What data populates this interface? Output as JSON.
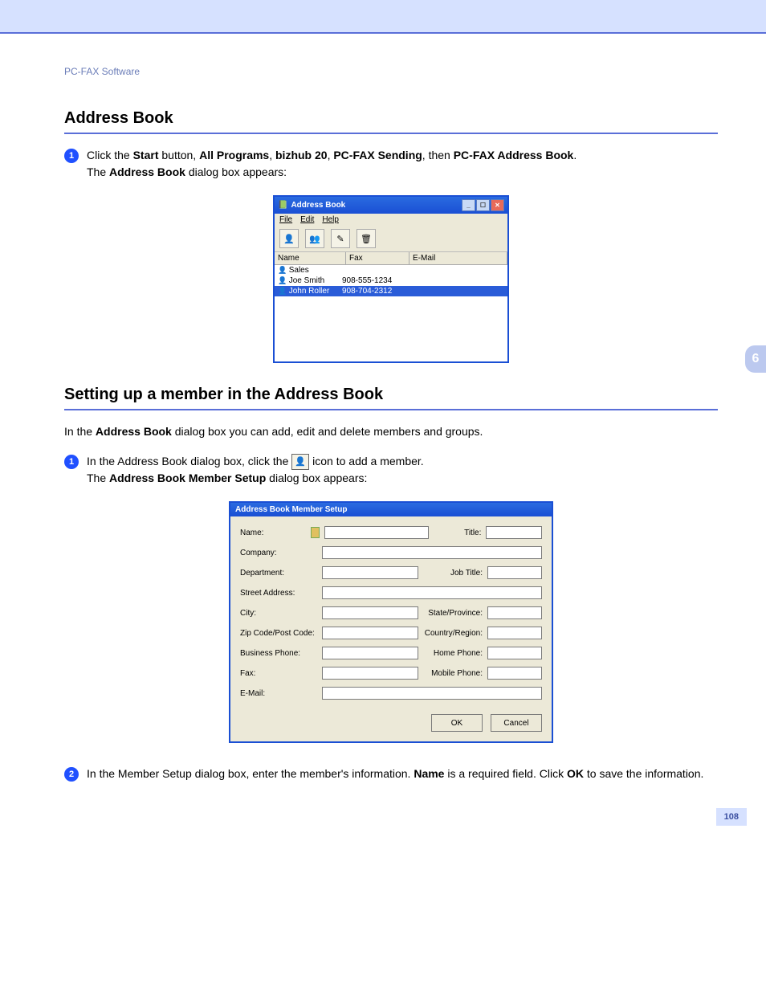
{
  "chapter_num": "6",
  "page_num": "108",
  "header": "PC-FAX Software",
  "h2_1": "Address Book",
  "h2_2": "Setting up a member in the Address Book",
  "step1": {
    "pre": "Click the ",
    "b1": "Start",
    "t1": " button, ",
    "b2": "All Programs",
    "t2": ", ",
    "b3": "bizhub 20",
    "t3": ", ",
    "b4": "PC-FAX Sending",
    "t4": ", then ",
    "b5": "PC-FAX Address Book",
    "t5": ".",
    "line2a": "The ",
    "line2b": "Address Book",
    "line2c": " dialog box appears:"
  },
  "intro2": {
    "a": "In the ",
    "b": "Address Book",
    "c": " dialog box you can add, edit and delete members and groups."
  },
  "step2a": {
    "a": "In the Address Book dialog box, click the ",
    "b": " icon to add a member.",
    "c1": "The ",
    "c2": "Address Book Member Setup",
    "c3": " dialog box appears:"
  },
  "step2b": {
    "a": "In the Member Setup dialog box, enter the member's information. ",
    "b": "Name",
    "c": " is a required field. Click ",
    "d": "OK",
    "e": " to save the information."
  },
  "ab": {
    "title": "Address Book",
    "menu": {
      "file": "File",
      "edit": "Edit",
      "help": "Help"
    },
    "cols": {
      "name": "Name",
      "fax": "Fax",
      "email": "E-Mail"
    },
    "rows": [
      {
        "name": "Sales",
        "fax": "",
        "email": ""
      },
      {
        "name": "Joe Smith",
        "fax": "908-555-1234",
        "email": ""
      },
      {
        "name": "John Roller",
        "fax": "908-704-2312",
        "email": ""
      }
    ]
  },
  "ms": {
    "title": "Address Book Member Setup",
    "labels": {
      "name": "Name:",
      "title": "Title:",
      "company": "Company:",
      "department": "Department:",
      "jobtitle": "Job Title:",
      "street": "Street Address:",
      "city": "City:",
      "state": "State/Province:",
      "zip": "Zip Code/Post Code:",
      "country": "Country/Region:",
      "busphone": "Business Phone:",
      "homephone": "Home Phone:",
      "fax": "Fax:",
      "mobile": "Mobile Phone:",
      "email": "E-Mail:"
    },
    "ok": "OK",
    "cancel": "Cancel"
  }
}
